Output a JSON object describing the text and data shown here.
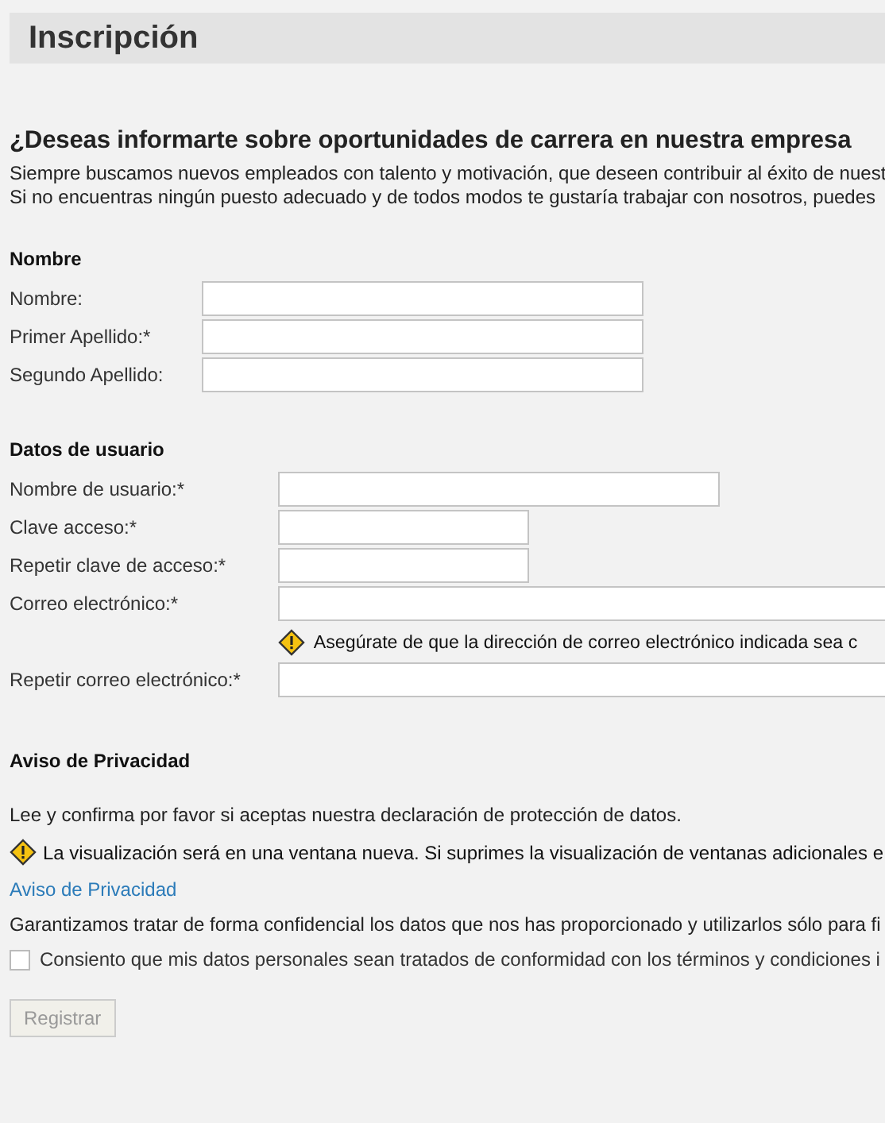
{
  "page_title": "Inscripción",
  "heading": "¿Deseas informarte sobre oportunidades de carrera en nuestra empresa",
  "intro": [
    "Siempre buscamos nuevos empleados con talento y motivación, que deseen contribuir al éxito de nuest",
    "Si no encuentras ningún puesto adecuado y de todos modos te gustaría trabajar con nosotros, puedes"
  ],
  "sections": [
    {
      "title": "Nombre",
      "fields": [
        {
          "label": "Nombre:",
          "kind": "long"
        },
        {
          "label": "Primer Apellido:*",
          "kind": "long"
        },
        {
          "label": "Segundo Apellido:",
          "kind": "long"
        }
      ]
    },
    {
      "title": "Datos de usuario",
      "fields": [
        {
          "label": "Nombre de usuario:*",
          "kind": "long"
        },
        {
          "label": "Clave acceso:*",
          "kind": "short"
        },
        {
          "label": "Repetir clave de acceso:*",
          "kind": "short"
        },
        {
          "label": "Correo electrónico:*",
          "kind": "full"
        },
        {
          "kind": "warning",
          "text": "Asegúrate de que la dirección de correo electrónico indicada sea c"
        },
        {
          "label": "Repetir correo electrónico:*",
          "kind": "full"
        }
      ]
    }
  ],
  "privacy": {
    "title": "Aviso de Privacidad",
    "text": "Lee y confirma por favor si aceptas nuestra declaración de protección de datos.",
    "warning": "La visualización será en una ventana nueva. Si suprimes la visualización de ventanas adicionales e",
    "link": "Aviso de Privacidad",
    "guarantee": "Garantizamos tratar de forma confidencial los datos que nos has proporcionado y utilizarlos sólo para fi",
    "consent": {
      "label": "Consiento que mis datos personales sean tratados de conformidad con los términos y condiciones i",
      "checked": false
    }
  },
  "submit": {
    "label": "Registrar",
    "disabled": true
  }
}
